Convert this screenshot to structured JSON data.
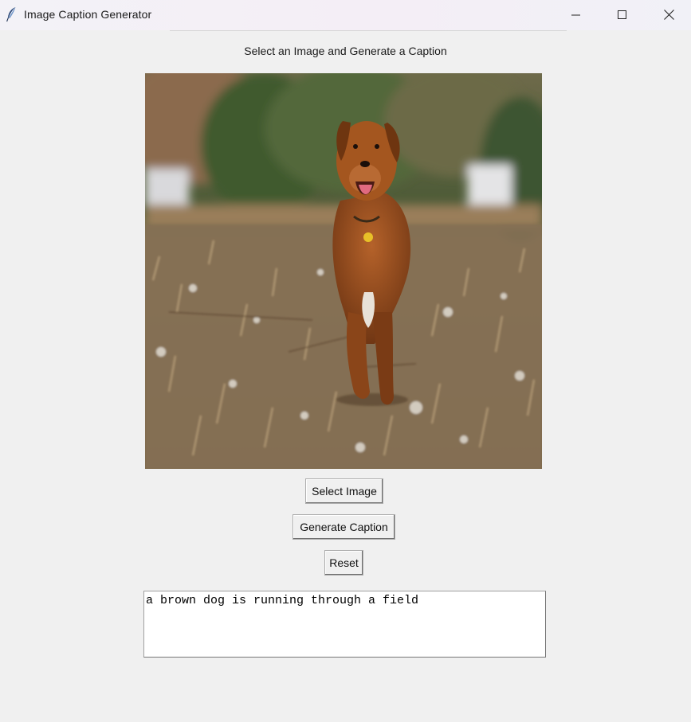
{
  "window": {
    "title": "Image Caption Generator",
    "app_icon": "feather-icon",
    "controls": [
      "minimize-icon",
      "maximize-icon",
      "close-icon"
    ]
  },
  "main": {
    "heading": "Select an Image and Generate a Caption",
    "image": {
      "icon": "photo-golden-dog-running-in-field"
    },
    "buttons": {
      "select_image": "Select Image",
      "generate_caption": "Generate Caption",
      "reset": "Reset"
    },
    "caption_text": "a brown dog is running through a field"
  },
  "colors": {
    "window_bg": "#f0f0f0",
    "textbox_bg": "#ffffff"
  }
}
